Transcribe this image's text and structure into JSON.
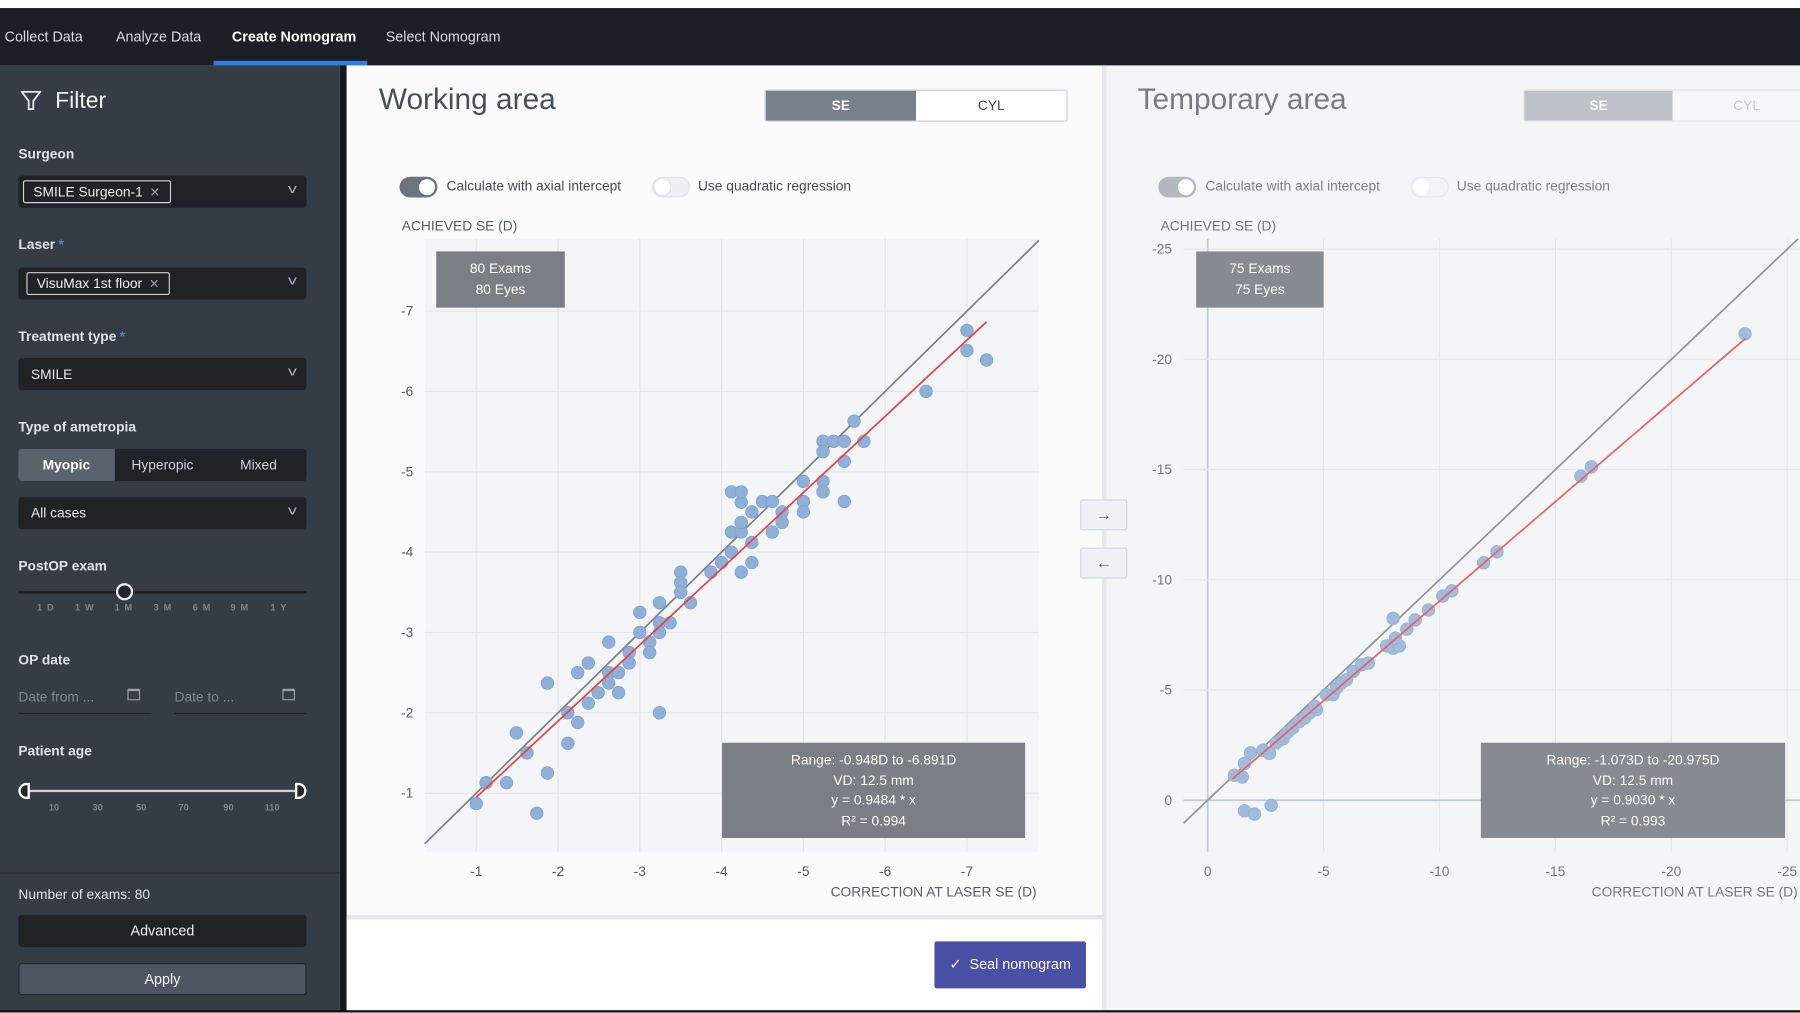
{
  "nav": {
    "tabs": [
      "Collect Data",
      "Analyze Data",
      "Create Nomogram",
      "Select Nomogram"
    ],
    "active": "Create Nomogram"
  },
  "filter": {
    "title": "Filter",
    "icon": "filter-icon",
    "surgeon": {
      "label": "Surgeon",
      "chip": "SMILE Surgeon-1"
    },
    "laser": {
      "label": "Laser",
      "required": "*",
      "chip": "VisuMax 1st floor"
    },
    "treatment": {
      "label": "Treatment type",
      "required": "*",
      "value": "SMILE"
    },
    "ametropia": {
      "label": "Type of ametropia",
      "options": [
        "Myopic",
        "Hyperopic",
        "Mixed"
      ],
      "selected": "Myopic",
      "cases": "All cases"
    },
    "postop": {
      "label": "PostOP exam",
      "ticks": [
        "1 D",
        "1 W",
        "1 M",
        "3 M",
        "6 M",
        "9 M",
        "1 Y"
      ],
      "selected": "1 M"
    },
    "opdate": {
      "label": "OP date",
      "from_placeholder": "Date from ...",
      "to_placeholder": "Date to ..."
    },
    "age": {
      "label": "Patient age",
      "ticks": [
        "10",
        "30",
        "50",
        "70",
        "90",
        "110"
      ]
    },
    "exam_count": "Number of exams: 80",
    "advanced": "Advanced",
    "apply": "Apply"
  },
  "working": {
    "title": "Working area",
    "seg": [
      "SE",
      "CYL"
    ],
    "seg_selected": "SE",
    "toggle1": {
      "label": "Calculate with axial intercept",
      "on": true
    },
    "toggle2": {
      "label": "Use quadratic regression",
      "on": false
    },
    "count": [
      "80 Exams",
      "80 Eyes"
    ],
    "stats": [
      "Range: -0.948D to -6.891D",
      "VD: 12.5 mm",
      "y = 0.9484 * x",
      "R² = 0.994"
    ]
  },
  "temporary": {
    "title": "Temporary area",
    "seg": [
      "SE",
      "CYL"
    ],
    "seg_selected": "SE",
    "toggle1": {
      "label": "Calculate with axial intercept",
      "on": true
    },
    "toggle2": {
      "label": "Use quadratic regression",
      "on": false
    },
    "count": [
      "75 Exams",
      "75 Eyes"
    ],
    "stats": [
      "Range: -1.073D to -20.975D",
      "VD: 12.5 mm",
      "y = 0.9030 * x",
      "R² = 0.993"
    ]
  },
  "buttons": {
    "move_right": "→",
    "move_left": "←",
    "seal": "Seal nomogram"
  },
  "colors": {
    "accent": "#2f7de1",
    "seal": "#4a50a6",
    "points": "#8fafd8",
    "fit": "#e8423f",
    "identity": "#7b7f86"
  },
  "chart_data": [
    {
      "type": "scatter",
      "xlabel": "CORRECTION AT LASER SE (D)",
      "ylabel": "ACHIEVED SE (D)",
      "xlim": [
        -0.37,
        -7.88
      ],
      "ylim": [
        -0.27,
        -7.9
      ],
      "xticks": [
        "-1",
        "-2",
        "-3",
        "-4",
        "-5",
        "-6",
        "-7"
      ],
      "yticks": [
        "-1",
        "-2",
        "-3",
        "-4",
        "-5",
        "-6",
        "-7"
      ],
      "grid": true,
      "zero_lines": false,
      "fit": {
        "slope": 0.9484,
        "x_range": [
          -1.0,
          -7.24
        ]
      },
      "identity_line": true,
      "points": [
        [
          -1.0,
          -0.87
        ],
        [
          -1.12,
          -1.13
        ],
        [
          -1.37,
          -1.13
        ],
        [
          -1.49,
          -1.75
        ],
        [
          -1.62,
          -1.5
        ],
        [
          -1.74,
          -0.75
        ],
        [
          -1.87,
          -2.37
        ],
        [
          -1.87,
          -1.25
        ],
        [
          -2.12,
          -1.62
        ],
        [
          -2.12,
          -2.0
        ],
        [
          -2.24,
          -1.88
        ],
        [
          -2.24,
          -2.5
        ],
        [
          -2.37,
          -2.62
        ],
        [
          -2.37,
          -2.12
        ],
        [
          -2.49,
          -2.25
        ],
        [
          -2.62,
          -2.88
        ],
        [
          -2.62,
          -2.5
        ],
        [
          -2.62,
          -2.37
        ],
        [
          -2.74,
          -2.5
        ],
        [
          -2.74,
          -2.25
        ],
        [
          -2.87,
          -2.75
        ],
        [
          -2.87,
          -2.62
        ],
        [
          -3.0,
          -3.25
        ],
        [
          -3.0,
          -3.0
        ],
        [
          -3.12,
          -2.88
        ],
        [
          -3.12,
          -2.75
        ],
        [
          -3.24,
          -3.37
        ],
        [
          -3.24,
          -3.12
        ],
        [
          -3.24,
          -3.0
        ],
        [
          -3.24,
          -2.0
        ],
        [
          -3.37,
          -3.12
        ],
        [
          -3.5,
          -3.75
        ],
        [
          -3.5,
          -3.62
        ],
        [
          -3.5,
          -3.5
        ],
        [
          -3.62,
          -3.37
        ],
        [
          -3.87,
          -3.75
        ],
        [
          -4.0,
          -3.87
        ],
        [
          -4.12,
          -4.0
        ],
        [
          -4.12,
          -4.25
        ],
        [
          -4.24,
          -4.25
        ],
        [
          -4.24,
          -4.37
        ],
        [
          -4.24,
          -3.75
        ],
        [
          -4.37,
          -4.5
        ],
        [
          -4.37,
          -4.12
        ],
        [
          -4.37,
          -3.87
        ],
        [
          -4.24,
          -4.62
        ],
        [
          -4.12,
          -4.75
        ],
        [
          -4.24,
          -4.75
        ],
        [
          -4.5,
          -4.63
        ],
        [
          -4.62,
          -4.63
        ],
        [
          -4.62,
          -4.25
        ],
        [
          -4.74,
          -4.5
        ],
        [
          -4.74,
          -4.37
        ],
        [
          -5.0,
          -4.88
        ],
        [
          -5.0,
          -4.63
        ],
        [
          -5.0,
          -4.5
        ],
        [
          -5.24,
          -5.38
        ],
        [
          -5.24,
          -5.25
        ],
        [
          -5.37,
          -5.38
        ],
        [
          -5.5,
          -5.38
        ],
        [
          -5.5,
          -5.13
        ],
        [
          -5.24,
          -4.88
        ],
        [
          -5.24,
          -4.75
        ],
        [
          -5.5,
          -4.63
        ],
        [
          -5.62,
          -5.63
        ],
        [
          -5.74,
          -5.38
        ],
        [
          -6.5,
          -6.0
        ],
        [
          -7.0,
          -6.76
        ],
        [
          -7.0,
          -6.51
        ],
        [
          -7.24,
          -6.39
        ]
      ]
    },
    {
      "type": "scatter",
      "xlabel": "CORRECTION AT LASER SE (D)",
      "ylabel": "ACHIEVED SE (D)",
      "xlim": [
        1.04,
        -25.55
      ],
      "ylim": [
        2.34,
        -25.47
      ],
      "xticks": [
        "0",
        "-5",
        "-10",
        "-15",
        "-20",
        "-25"
      ],
      "yticks": [
        "0",
        "-5",
        "-10",
        "-15",
        "-20",
        "-25"
      ],
      "grid": true,
      "zero_lines": true,
      "fit": {
        "slope": 0.903,
        "x_range": [
          -1.07,
          -23.2
        ]
      },
      "identity_line": true,
      "points": [
        [
          -1.15,
          -1.13
        ],
        [
          -1.49,
          -1.05
        ],
        [
          -1.59,
          -1.67
        ],
        [
          -1.85,
          -2.15
        ],
        [
          -1.59,
          0.48
        ],
        [
          -2.02,
          0.63
        ],
        [
          -2.74,
          0.23
        ],
        [
          -2.38,
          -2.27
        ],
        [
          -2.67,
          -2.12
        ],
        [
          -2.96,
          -2.6
        ],
        [
          -3.25,
          -2.78
        ],
        [
          -3.46,
          -3.09
        ],
        [
          -3.68,
          -3.28
        ],
        [
          -3.97,
          -3.58
        ],
        [
          -4.18,
          -3.73
        ],
        [
          -4.4,
          -3.96
        ],
        [
          -4.69,
          -4.11
        ],
        [
          -4.62,
          -4.26
        ],
        [
          -5.12,
          -4.79
        ],
        [
          -5.41,
          -4.79
        ],
        [
          -5.56,
          -5.09
        ],
        [
          -5.77,
          -5.32
        ],
        [
          -5.99,
          -5.47
        ],
        [
          -6.28,
          -5.84
        ],
        [
          -6.64,
          -6.14
        ],
        [
          -6.93,
          -6.22
        ],
        [
          -7.72,
          -7.0
        ],
        [
          -8.0,
          -6.9
        ],
        [
          -8.27,
          -7.0
        ],
        [
          -8.1,
          -7.35
        ],
        [
          -8.0,
          -8.25
        ],
        [
          -8.59,
          -7.76
        ],
        [
          -8.95,
          -8.18
        ],
        [
          -9.52,
          -8.63
        ],
        [
          -10.14,
          -9.26
        ],
        [
          -10.53,
          -9.5
        ],
        [
          -11.9,
          -10.77
        ],
        [
          -12.48,
          -11.27
        ],
        [
          -16.1,
          -14.7
        ],
        [
          -16.55,
          -15.12
        ],
        [
          -23.18,
          -21.16
        ]
      ]
    }
  ]
}
